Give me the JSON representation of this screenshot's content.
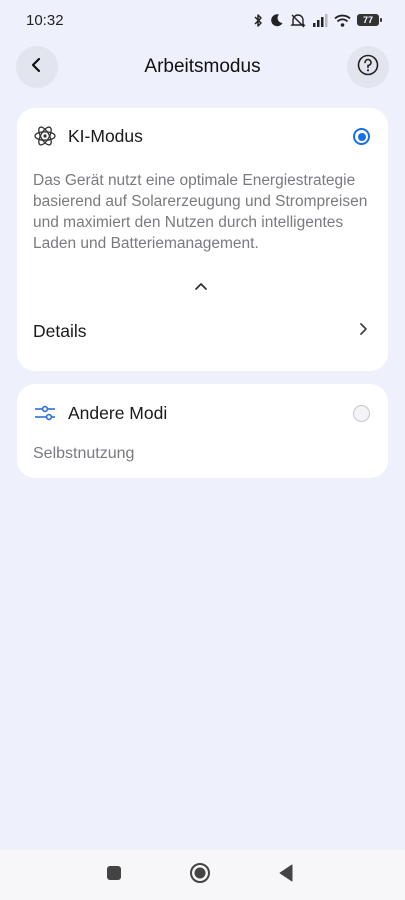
{
  "status_bar": {
    "time": "10:32",
    "battery_level": "77",
    "icons": [
      "bluetooth-icon",
      "moon-icon",
      "mute-icon",
      "signal-icon",
      "wifi-icon",
      "battery-icon"
    ]
  },
  "header": {
    "title": "Arbeitsmodus",
    "back_icon": "chevron-left-icon",
    "help_icon": "question-circle-icon"
  },
  "ki_card": {
    "icon": "atom-icon",
    "label": "KI-Modus",
    "selected": true,
    "description": "Das Gerät nutzt eine optimale Energiestrategie basierend auf Solarerzeugung und Strompreisen und maximiert den Nutzen durch intelligentes Laden und Batteriemanagement.",
    "details_label": "Details"
  },
  "other_card": {
    "icon": "sliders-icon",
    "label": "Andere Modi",
    "selected": false,
    "sub_label": "Selbstnutzung"
  },
  "nav_bar": {
    "buttons": [
      "square-icon",
      "home-circle-icon",
      "back-triangle-icon"
    ]
  },
  "colors": {
    "background": "#eef1fb",
    "accent": "#1a6ee8",
    "secondary_text": "#7a7a80"
  }
}
